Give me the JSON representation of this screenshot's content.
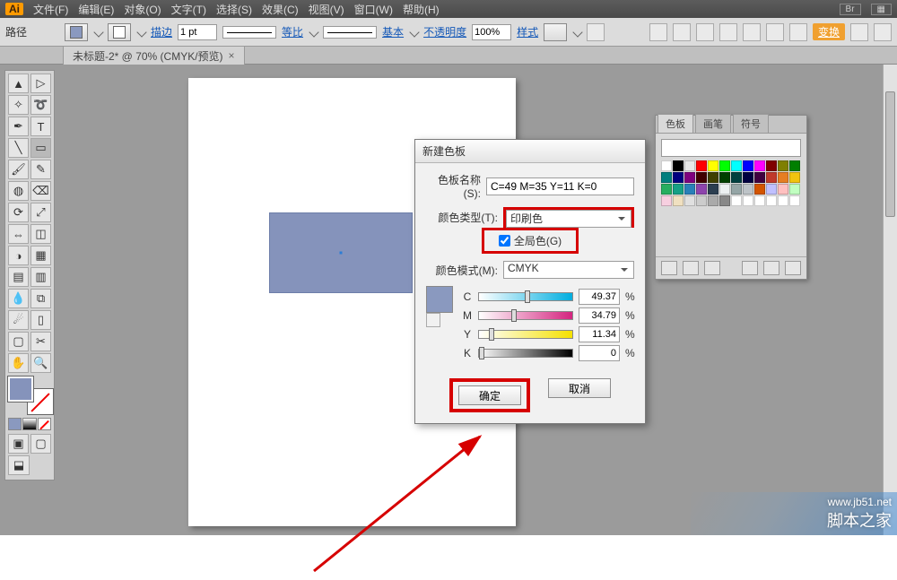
{
  "app": {
    "logo": "Ai"
  },
  "menus": [
    "文件(F)",
    "编辑(E)",
    "对象(O)",
    "文字(T)",
    "选择(S)",
    "效果(C)",
    "视图(V)",
    "窗口(W)",
    "帮助(H)"
  ],
  "optbar": {
    "path_label": "路径",
    "stroke": "描边",
    "stroke_value": "1 pt",
    "dash_label": "等比",
    "profile_label": "基本",
    "opacity_label": "不透明度",
    "opacity_value": "100%",
    "style_label": "样式",
    "transform_btn": "变换"
  },
  "tab": {
    "title": "未标题-2* @ 70% (CMYK/预览)",
    "close": "×"
  },
  "panel": {
    "tabs": [
      "色板",
      "画笔",
      "符号"
    ],
    "colors": [
      "#ffffff",
      "#000000",
      "#e8e8e8",
      "#ff0000",
      "#ffff00",
      "#00ff00",
      "#00ffff",
      "#0000ff",
      "#ff00ff",
      "#7f0000",
      "#7f7f00",
      "#007f00",
      "#007f7f",
      "#00007f",
      "#7f007f",
      "#400000",
      "#404000",
      "#004000",
      "#004040",
      "#000040",
      "#400040",
      "#c0392b",
      "#e67e22",
      "#f1c40f",
      "#27ae60",
      "#16a085",
      "#2980b9",
      "#8e44ad",
      "#2c3e50",
      "#ecf0f1",
      "#95a5a6",
      "#bdc3c7",
      "#d35400",
      "#c0c0ff",
      "#ffc0c0",
      "#c0ffc0",
      "#f7cfe0",
      "#f0e0c0",
      "#e0e0e0",
      "#cccccc",
      "#aaaaaa",
      "#888888",
      "#ffffff",
      "#ffffff",
      "#ffffff",
      "#ffffff",
      "#ffffff",
      "#ffffff"
    ]
  },
  "dialog": {
    "title": "新建色板",
    "name_label": "色板名称(S):",
    "name_value": "C=49 M=35 Y=11 K=0",
    "type_label": "颜色类型(T):",
    "type_value": "印刷色",
    "global_label": "全局色(G)",
    "mode_label": "颜色模式(M):",
    "mode_value": "CMYK",
    "c": "49.37",
    "m": "34.79",
    "y": "11.34",
    "k": "0",
    "pct": "%",
    "ok": "确定",
    "cancel": "取消"
  },
  "watermark": {
    "url": "www.jb51.net",
    "cn": "脚本之家"
  }
}
